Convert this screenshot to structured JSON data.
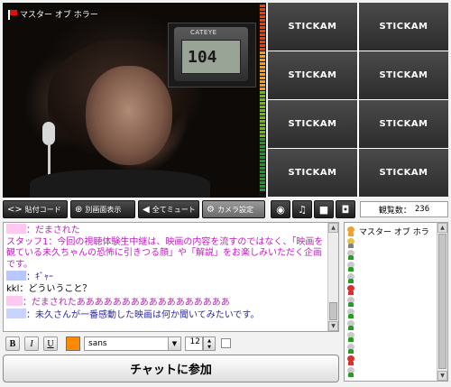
{
  "broadcaster": {
    "name": "マスター オブ ホラー"
  },
  "inset": {
    "brand": "CATEYE",
    "reading": "104"
  },
  "grid": {
    "slots": [
      "STICKAM",
      "STICKAM",
      "STICKAM",
      "STICKAM",
      "STICKAM",
      "STICKAM"
    ]
  },
  "toolbar": {
    "embed_code": "貼付コード",
    "popout": "別画面表示",
    "mute_all": "全てミュート",
    "camera_settings": "カメラ設定",
    "viewer_count_label": "観覧数：",
    "viewer_count": "236"
  },
  "chat": {
    "lines": [
      {
        "name_color": "#ffc8f0",
        "text": "：だまされた",
        "text_color": "#c020c0"
      },
      {
        "text": "スタッフ1：今回の視聴体験生中継は、映画の内容を流すのではなく、「映画を観ている未久ちゃんの恐怖に引きつる顔」や「解説」をお楽しみいただく企画です。",
        "text_color": "#c020c0"
      },
      {
        "name_color": "#b8c8ff",
        "text": "：ｷﾞｬｰ",
        "text_color": "#2a2aa0"
      },
      {
        "text": "kkl：どういうこと？",
        "text_color": "#000000"
      },
      {
        "name_color": "#ffc8f0",
        "text": "：だまされたあああああああああああああああああ",
        "text_color": "#c020c0"
      },
      {
        "name_color": "#c8d4ff",
        "text": "：未久さんが一番感動した映画は何か聞いてみたいです。",
        "text_color": "#2a2aa0"
      }
    ]
  },
  "users": {
    "list": [
      {
        "name": "マスター オブ ホラ",
        "head": "#f0a030",
        "body": "#f0a030"
      },
      {
        "name": "",
        "head": "#e8c040",
        "body": "#808080"
      },
      {
        "name": "",
        "head": "#c8c8c8",
        "body": "#20a020"
      },
      {
        "name": "",
        "head": "#c8c8c8",
        "body": "#20a020"
      },
      {
        "name": "",
        "head": "#c8c8c8",
        "body": "#20a020"
      },
      {
        "name": "",
        "head": "#d83030",
        "body": "#d83030"
      },
      {
        "name": "",
        "head": "#c8c8c8",
        "body": "#20a020"
      },
      {
        "name": "",
        "head": "#c8c8c8",
        "body": "#20a020"
      },
      {
        "name": "",
        "head": "#c8c8c8",
        "body": "#20a020"
      },
      {
        "name": "",
        "head": "#c8c8c8",
        "body": "#20a020"
      },
      {
        "name": "",
        "head": "#c8c8c8",
        "body": "#20a020"
      },
      {
        "name": "",
        "head": "#d83030",
        "body": "#d83030"
      },
      {
        "name": "",
        "head": "#c8c8c8",
        "body": "#20a020"
      }
    ]
  },
  "format": {
    "bold": "B",
    "italic": "I",
    "underline": "U",
    "color": "#ff8a00",
    "font": "sans",
    "size": "12"
  },
  "join": {
    "label": "チャットに参加"
  }
}
